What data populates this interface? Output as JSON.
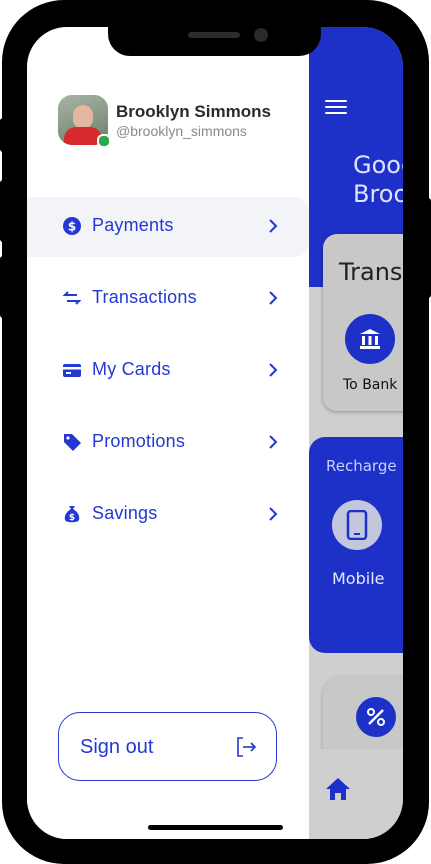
{
  "profile": {
    "name": "Brooklyn Simmons",
    "handle": "@brooklyn_simmons"
  },
  "menu": {
    "items": [
      {
        "label": "Payments",
        "icon": "dollar-coin-icon",
        "active": true
      },
      {
        "label": "Transactions",
        "icon": "transfer-arrows-icon",
        "active": false
      },
      {
        "label": "My Cards",
        "icon": "credit-card-icon",
        "active": false
      },
      {
        "label": "Promotions",
        "icon": "tag-icon",
        "active": false
      },
      {
        "label": "Savings",
        "icon": "money-bag-icon",
        "active": false
      }
    ]
  },
  "signout": {
    "label": "Sign out",
    "icon": "logout-icon"
  },
  "background_app": {
    "greeting": "Good\nBroo",
    "transfer_card_title": "Trans",
    "to_bank_label": "To Bank",
    "recharge_title": "Recharge",
    "mobile_label": "Mobile"
  },
  "colors": {
    "accent": "#2339d1",
    "background_blue": "#1d31c9",
    "online": "#2ca84a"
  }
}
